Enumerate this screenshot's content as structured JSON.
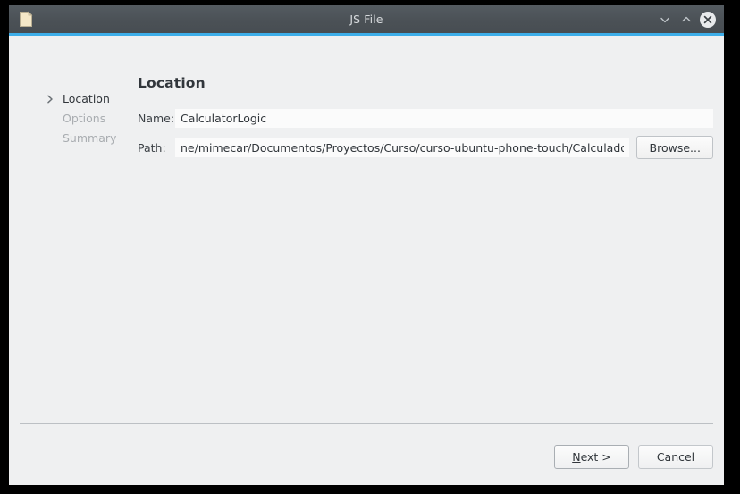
{
  "window": {
    "title": "JS File",
    "app_icon": "document-icon",
    "accent_color": "#3daee9",
    "titlebar_color": "#4b5156",
    "background_color": "#eff0f1",
    "controls": [
      {
        "name": "minimize-button",
        "icon": "chevron-down-icon",
        "label": "Minimize"
      },
      {
        "name": "maximize-button",
        "icon": "chevron-up-icon",
        "label": "Maximize"
      },
      {
        "name": "close-button",
        "icon": "close-icon",
        "label": "Close"
      }
    ]
  },
  "sidebar": {
    "items": [
      {
        "label": "Location",
        "state": "active",
        "icon": "chevron-right-icon"
      },
      {
        "label": "Options",
        "state": "disabled",
        "icon": ""
      },
      {
        "label": "Summary",
        "state": "disabled",
        "icon": ""
      }
    ]
  },
  "main": {
    "page_title": "Location",
    "fields": {
      "name": {
        "label": "Name:",
        "value": "CalculatorLogic",
        "placeholder": ""
      },
      "path": {
        "label": "Path:",
        "value": "ne/mimecar/Documentos/Proyectos/Curso/curso-ubuntu-phone-touch/Calculadora/Calculadora",
        "placeholder": "",
        "browse_label": "Browse..."
      }
    }
  },
  "footer": {
    "next_label_prefix": "N",
    "next_label_rest": "ext >",
    "cancel_label": "Cancel"
  }
}
